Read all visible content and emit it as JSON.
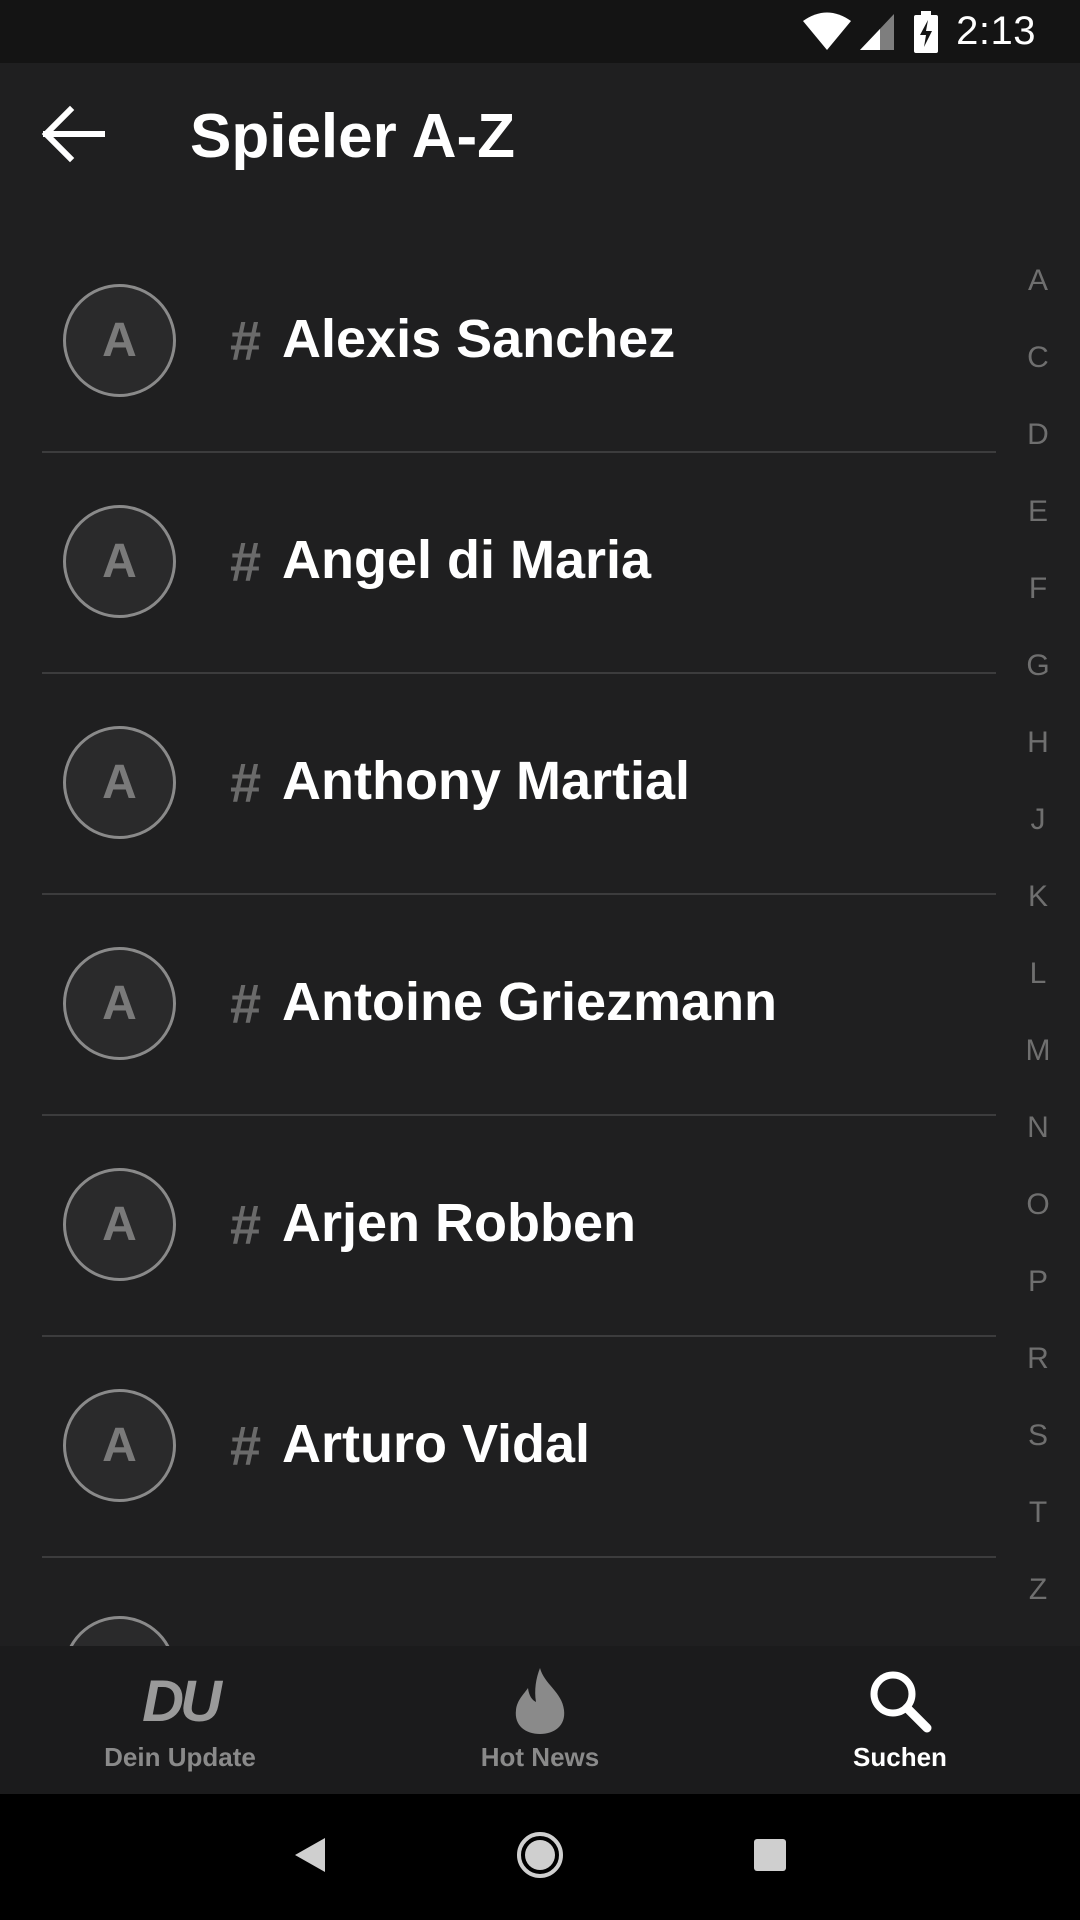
{
  "status_bar": {
    "time": "2:13"
  },
  "app_bar": {
    "title": "Spieler A-Z"
  },
  "players": [
    {
      "initial": "A",
      "hash": "#",
      "name": "Alexis Sanchez"
    },
    {
      "initial": "A",
      "hash": "#",
      "name": "Angel di Maria"
    },
    {
      "initial": "A",
      "hash": "#",
      "name": "Anthony Martial"
    },
    {
      "initial": "A",
      "hash": "#",
      "name": "Antoine Griezmann"
    },
    {
      "initial": "A",
      "hash": "#",
      "name": "Arjen Robben"
    },
    {
      "initial": "A",
      "hash": "#",
      "name": "Arturo Vidal"
    }
  ],
  "alphabet_index": [
    "A",
    "C",
    "D",
    "E",
    "F",
    "G",
    "H",
    "J",
    "K",
    "L",
    "M",
    "N",
    "O",
    "P",
    "R",
    "S",
    "T",
    "Z"
  ],
  "bottom_nav": {
    "items": [
      {
        "label": "Dein Update",
        "icon": "du-logo-icon",
        "logo_text": "DU",
        "active": false
      },
      {
        "label": "Hot News",
        "icon": "flame-icon",
        "active": false
      },
      {
        "label": "Suchen",
        "icon": "search-icon",
        "active": true
      }
    ]
  },
  "colors": {
    "background": "#1f1f20",
    "text_primary": "#ffffff",
    "text_muted": "#6f6f6f",
    "active_tab": "#ffffff",
    "inactive_tab": "#8a8a8a"
  }
}
